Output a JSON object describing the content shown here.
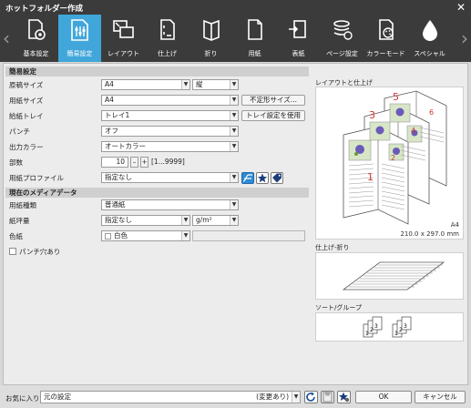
{
  "window": {
    "title": "ホットフォルダー作成",
    "close_glyph": "✕"
  },
  "toolbar": {
    "tabs": [
      {
        "label": "基本設定",
        "icon": "gear-page-icon"
      },
      {
        "label": "簡易設定",
        "icon": "sliders-icon"
      },
      {
        "label": "レイアウト",
        "icon": "layout-icon"
      },
      {
        "label": "仕上げ",
        "icon": "finishing-icon"
      },
      {
        "label": "折り",
        "icon": "fold-icon"
      },
      {
        "label": "用紙",
        "icon": "paper-icon"
      },
      {
        "label": "表紙",
        "icon": "cover-icon"
      },
      {
        "label": "ページ設定",
        "icon": "page-settings-icon"
      },
      {
        "label": "カラーモード",
        "icon": "palette-icon"
      },
      {
        "label": "スペシャル",
        "icon": "drop-icon"
      }
    ],
    "active_index": 1,
    "active_color": "#41a6da"
  },
  "simple": {
    "section_title": "簡易設定",
    "original_size": {
      "label": "原稿サイズ",
      "value": "A4",
      "orientation": "縦"
    },
    "paper_size": {
      "label": "用紙サイズ",
      "value": "A4",
      "button": "不定形サイズ..."
    },
    "feed_tray": {
      "label": "給紙トレイ",
      "value": "トレイ1",
      "button": "トレイ設定を使用"
    },
    "punch": {
      "label": "パンチ",
      "value": "オフ"
    },
    "output_color": {
      "label": "出力カラー",
      "value": "オートカラー"
    },
    "copies": {
      "label": "部数",
      "value": "10",
      "minus": "–",
      "plus": "+",
      "range": "[1...9999]"
    },
    "paper_profile": {
      "label": "用紙プロファイル",
      "value": "指定なし"
    }
  },
  "media": {
    "section_title": "現在のメディアデータ",
    "paper_type": {
      "label": "用紙種類",
      "value": "普通紙"
    },
    "basis_weight": {
      "label": "紙坪量",
      "value": "指定なし",
      "unit": "g/m²"
    },
    "color_paper": {
      "label": "色紙",
      "value": "白色"
    },
    "punched": {
      "label": "パンチ穴あり",
      "checked": false
    }
  },
  "preview": {
    "layout_title": "レイアウトと仕上げ",
    "page_numbers": [
      "5",
      "6",
      "3",
      "4",
      "1",
      "2"
    ],
    "paper_name": "A4",
    "paper_dims": "210.0 x 297.0 mm",
    "fold_title": "仕上げ-折り",
    "sort_title": "ソート/グループ",
    "sort_numbers": [
      "1",
      "2",
      "3",
      "1",
      "2",
      "3"
    ]
  },
  "footer": {
    "favorites_label": "お気に入り",
    "favorites_value": "元の設定",
    "modified": "(変更あり)",
    "ok": "OK",
    "cancel": "キャンセル"
  }
}
